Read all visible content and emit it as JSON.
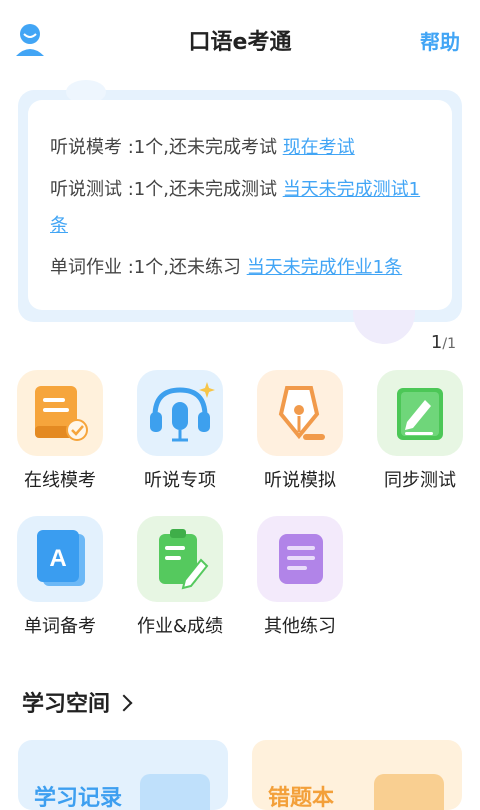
{
  "header": {
    "title": "口语e考通",
    "help": "帮助"
  },
  "notice": {
    "lines": [
      {
        "text": "听说模考 :1个,还未完成考试 ",
        "link": "现在考试"
      },
      {
        "text": "听说测试 :1个,还未完成测试 ",
        "link": "当天未完成测试1条"
      },
      {
        "text": "单词作业 :1个,还未练习 ",
        "link": "当天未完成作业1条"
      }
    ],
    "pager_current": "1",
    "pager_total": "/1"
  },
  "grid": [
    {
      "label": "在线模考",
      "icon": "exam-paper-icon",
      "color": "#f6a53c"
    },
    {
      "label": "听说专项",
      "icon": "headset-mic-icon",
      "color": "#3da0ee"
    },
    {
      "label": "听说模拟",
      "icon": "pen-nib-icon",
      "color": "#f19a4b"
    },
    {
      "label": "同步测试",
      "icon": "notebook-pen-icon",
      "color": "#4cc757"
    },
    {
      "label": "单词备考",
      "icon": "vocabulary-book-icon",
      "color": "#3a9df0"
    },
    {
      "label": "作业&成绩",
      "icon": "clipboard-icon",
      "color": "#55c95e"
    },
    {
      "label": "其他练习",
      "icon": "list-doc-icon",
      "color": "#b184e8"
    }
  ],
  "space": {
    "title": "学习空间",
    "cards": [
      {
        "label": "学习记录",
        "color": "#3d9ff0"
      },
      {
        "label": "错题本",
        "color": "#f3a03a"
      }
    ]
  }
}
